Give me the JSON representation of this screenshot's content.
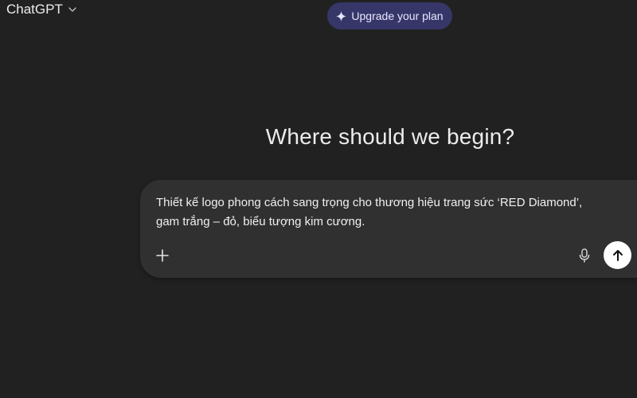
{
  "header": {
    "model_name": "ChatGPT",
    "model_chevron_icon": "chevron-down-icon",
    "upgrade_label": "Upgrade your plan",
    "upgrade_icon": "sparkle-icon"
  },
  "main": {
    "headline": "Where should we begin?"
  },
  "composer": {
    "value_lines": [
      "Thiết kế logo phong cách sang trọng cho thương hiệu trang sức ‘RED Diamond’,",
      "gam trắng – đỏ, biểu tượng kim cương."
    ],
    "add_icon": "plus-icon",
    "mic_icon": "microphone-icon",
    "send_icon": "arrow-up-icon"
  },
  "colors": {
    "background": "#212121",
    "composer_bg": "#303030",
    "upgrade_bg": "#373669",
    "send_bg": "#ffffff"
  }
}
